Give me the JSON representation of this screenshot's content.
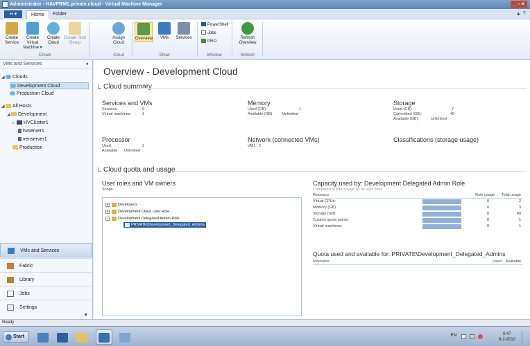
{
  "window": {
    "title": "Administrator - HAVPRM1.private.cloud - Virtual Machine Manager",
    "controls": "_ ▫ ×"
  },
  "tabs": {
    "file": "▪▪ ▾",
    "home": "Home",
    "folder": "Folder",
    "help": "▲ ?"
  },
  "ribbon": {
    "create": {
      "label": "Create",
      "buttons": [
        {
          "label": "Create Service",
          "icon": "create-service-icon"
        },
        {
          "label": "Create Virtual Machine ▾",
          "icon": "create-vm-icon"
        },
        {
          "label": "Create Cloud",
          "icon": "create-cloud-icon"
        },
        {
          "label": "Create Host Group",
          "icon": "create-host-group-icon"
        }
      ]
    },
    "cloud": {
      "label": "Cloud",
      "buttons": [
        {
          "label": "Assign Cloud",
          "icon": "assign-cloud-icon"
        }
      ]
    },
    "show": {
      "label": "Show",
      "buttons": [
        {
          "label": "Overview",
          "icon": "overview-icon"
        },
        {
          "label": "VMs",
          "icon": "vms-icon"
        },
        {
          "label": "Services",
          "icon": "services-icon"
        }
      ]
    },
    "window": {
      "label": "Window",
      "buttons": [
        {
          "label": "PowerShell",
          "icon": "powershell-icon"
        },
        {
          "label": "Jobs",
          "icon": "jobs-icon"
        },
        {
          "label": "PRO",
          "icon": "pro-icon"
        }
      ]
    },
    "refresh": {
      "label": "Refresh",
      "buttons": [
        {
          "label": "Refresh Overview",
          "icon": "refresh-icon"
        }
      ]
    }
  },
  "nav": {
    "header": "VMs and Services",
    "pin": "◂",
    "tree": {
      "clouds": "Clouds",
      "dev_cloud": "Development Cloud",
      "prod_cloud": "Production Cloud",
      "all_hosts": "All Hosts",
      "development": "Development",
      "hvcluster": "HVCluster1",
      "hvserver": "hvserver1",
      "venserver": "venserver1",
      "production": "Production"
    },
    "workspaces": [
      "VMs and Services",
      "Fabric",
      "Library",
      "Jobs",
      "Settings"
    ],
    "overflow": "▾"
  },
  "main": {
    "title": "Overview - Development Cloud",
    "cloud_summary": "Cloud summary",
    "services_vms": {
      "title": "Services and VMs",
      "services_label": "Services:",
      "services_value": "0",
      "vms_label": "Virtual machines:",
      "vms_value": "1"
    },
    "memory": {
      "title": "Memory",
      "used_label": "Used (GB):",
      "used_value": "1",
      "avail_label": "Available (GB):",
      "avail_value": "Unlimited"
    },
    "storage": {
      "title": "Storage",
      "used_label": "Used (GB):",
      "used_value": "7",
      "committed_label": "Committed (GB):",
      "committed_value": "40",
      "avail_label": "Available (GB):",
      "avail_value": "Unlimited"
    },
    "processor": {
      "title": "Processor",
      "used_label": "Used:",
      "used_value": "2",
      "avail_label": "Available:",
      "avail_value": "Unlimited"
    },
    "network": {
      "title": "Network (connected VMs)",
      "vm_label": "VM1:",
      "vm_value": "2"
    },
    "classifications": {
      "title": "Classifications (storage usage)"
    },
    "quota_section": "Cloud quota and usage",
    "roles": {
      "title": "User roles and VM owners",
      "scope": "Scope:",
      "items": [
        "Developers",
        "Development Cloud User Role",
        "Development Delegated Admin Role",
        "PRIVATE\\Development_Delegated_Admins"
      ]
    },
    "capacity": {
      "title": "Capacity used by: Development Delegated Admin Role",
      "subtitle": "Compared to total usage by all user roles",
      "col_resource": "Resource",
      "col_role": "Role usage",
      "col_total": "Total usage",
      "rows": [
        {
          "name": "Virtual CPUs:",
          "role": "0",
          "total": "2"
        },
        {
          "name": "Memory (GB):",
          "role": "0",
          "total": "3"
        },
        {
          "name": "Storage (GB):",
          "role": "0",
          "total": "40"
        },
        {
          "name": "Custom quota points:",
          "role": "0",
          "total": "1"
        },
        {
          "name": "Virtual machines:",
          "role": "0",
          "total": "1"
        }
      ]
    },
    "quota_avail": {
      "title": "Quota used and available for: PRIVATE\\Development_Delegated_Admins",
      "col_resource": "Resource",
      "col_used": "Used",
      "col_available": "Available"
    }
  },
  "status": "Ready",
  "taskbar": {
    "start": "Start",
    "lang": "EN",
    "time": "0:47",
    "date": "6-2-2012"
  },
  "colors": {
    "accent": "#2d5fa3",
    "selection": "#cde0f5",
    "bar": "#8fb0d8"
  }
}
